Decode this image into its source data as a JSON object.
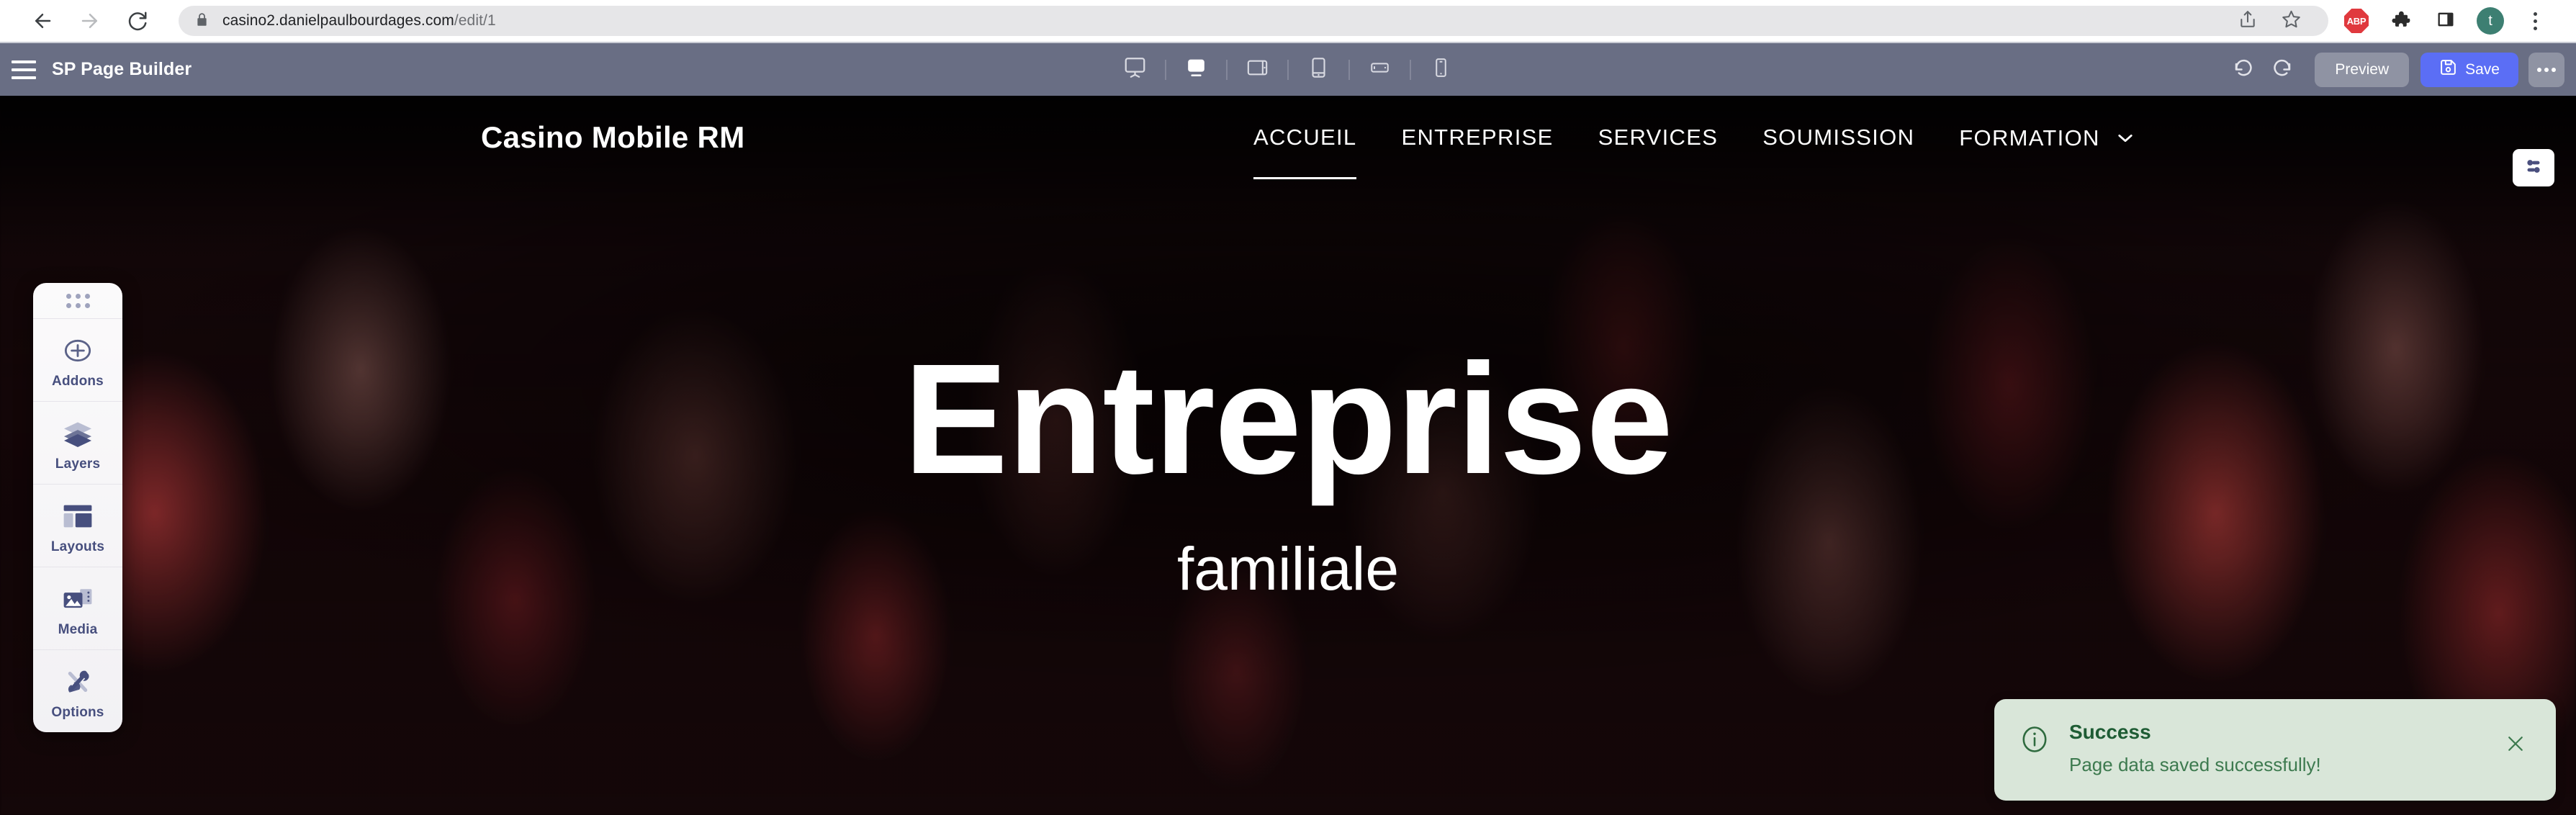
{
  "browser": {
    "back_label": "Back",
    "forward_label": "Forward",
    "reload_label": "Reload",
    "url_secure": "casino2.danielpaulbourdages.com",
    "url_path": "/edit/1",
    "share_label": "Share",
    "bookmark_label": "Bookmark",
    "adblock_label": "ABP",
    "extensions_label": "Extensions",
    "sidepanel_label": "Side panel",
    "profile_initial": "t",
    "menu_label": "Customize and control"
  },
  "builder": {
    "title": "SP Page Builder",
    "menu_label": "Menu",
    "devices": [
      {
        "name": "desktop",
        "label": "Desktop",
        "active": false
      },
      {
        "name": "laptop",
        "label": "Laptop",
        "active": true
      },
      {
        "name": "tablet-landscape",
        "label": "Tablet Landscape",
        "active": false
      },
      {
        "name": "tablet-portrait",
        "label": "Tablet Portrait",
        "active": false
      },
      {
        "name": "mobile-landscape",
        "label": "Mobile Landscape",
        "active": false
      },
      {
        "name": "mobile-portrait",
        "label": "Mobile Portrait",
        "active": false
      }
    ],
    "undo_label": "Undo",
    "redo_label": "Redo",
    "preview_label": "Preview",
    "save_label": "Save",
    "more_label": "More options",
    "save_color": "#5b6ef5",
    "toolbar_color": "#696e84"
  },
  "tool_panel": {
    "drag_handle_label": "Drag panel",
    "items": [
      {
        "icon": "plus-circle-icon",
        "label": "Addons"
      },
      {
        "icon": "layers-icon",
        "label": "Layers"
      },
      {
        "icon": "layouts-icon",
        "label": "Layouts"
      },
      {
        "icon": "media-icon",
        "label": "Media"
      },
      {
        "icon": "tools-icon",
        "label": "Options"
      }
    ],
    "label_color": "#474f7e"
  },
  "site": {
    "logo": "Casino Mobile RM",
    "nav": [
      {
        "label": "ACCUEIL",
        "active": true,
        "has_dropdown": false
      },
      {
        "label": "ENTREPRISE",
        "active": false,
        "has_dropdown": false
      },
      {
        "label": "SERVICES",
        "active": false,
        "has_dropdown": false
      },
      {
        "label": "SOUMISSION",
        "active": false,
        "has_dropdown": false
      },
      {
        "label": "FORMATION",
        "active": false,
        "has_dropdown": true
      }
    ],
    "settings_button_label": "Section settings",
    "hero": {
      "title": "Entreprise",
      "subtitle": "familiale"
    }
  },
  "toast": {
    "icon": "info-circle-icon",
    "title": "Success",
    "message": "Page data saved successfully!",
    "close_label": "Close",
    "bg_color": "#d9e6d9",
    "title_color": "#1e5c34"
  }
}
